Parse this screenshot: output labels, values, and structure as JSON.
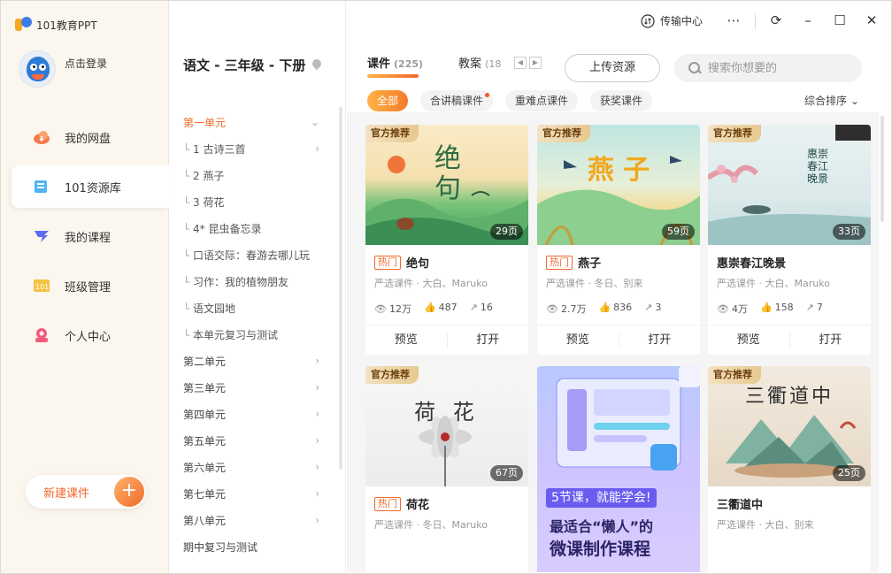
{
  "app": {
    "brand": "101教育PPT"
  },
  "user": {
    "login_label": "点击登录"
  },
  "nav": {
    "items": [
      {
        "label": "我的网盘",
        "icon": "cloud-disk-icon"
      },
      {
        "label": "101资源库",
        "icon": "resource-library-icon",
        "active": true
      },
      {
        "label": "我的课程",
        "icon": "course-icon"
      },
      {
        "label": "班级管理",
        "icon": "class-icon"
      },
      {
        "label": "个人中心",
        "icon": "user-center-icon"
      }
    ],
    "new_button": "新建课件"
  },
  "chapter": {
    "title": "语文 - 三年级 - 下册",
    "units": [
      {
        "label": "第一单元",
        "type": "unit-active"
      },
      {
        "label": "1 古诗三首",
        "type": "sub",
        "chev": true
      },
      {
        "label": "2 燕子",
        "type": "sub"
      },
      {
        "label": "3 荷花",
        "type": "sub"
      },
      {
        "label": "4* 昆虫备忘录",
        "type": "sub"
      },
      {
        "label": "口语交际：春游去哪儿玩",
        "type": "sub"
      },
      {
        "label": "习作：我的植物朋友",
        "type": "sub"
      },
      {
        "label": "语文园地",
        "type": "sub"
      },
      {
        "label": "本单元复习与测试",
        "type": "sub"
      },
      {
        "label": "第二单元",
        "type": "unit",
        "chev": true
      },
      {
        "label": "第三单元",
        "type": "unit",
        "chev": true
      },
      {
        "label": "第四单元",
        "type": "unit",
        "chev": true
      },
      {
        "label": "第五单元",
        "type": "unit",
        "chev": true
      },
      {
        "label": "第六单元",
        "type": "unit",
        "chev": true
      },
      {
        "label": "第七单元",
        "type": "unit",
        "chev": true
      },
      {
        "label": "第八单元",
        "type": "unit",
        "chev": true
      },
      {
        "label": "期中复习与测试",
        "type": "unit"
      }
    ]
  },
  "titlebar": {
    "transfer": "传输中心"
  },
  "tabs": [
    {
      "label": "课件",
      "count": "(225)"
    },
    {
      "label": "教案",
      "count": "(18"
    }
  ],
  "upload_label": "上传资源",
  "search": {
    "placeholder": "搜索你想要的"
  },
  "filters": [
    "全部",
    "合讲稿课件",
    "重难点课件",
    "获奖课件"
  ],
  "sort_label": "综合排序",
  "official_label": "官方推荐",
  "hot_label": "热门",
  "actions": {
    "preview": "预览",
    "open": "打开"
  },
  "cards": [
    {
      "title": "绝句",
      "hot": true,
      "meta": "严选课件 · 大白、Maruko",
      "pages": "29页",
      "views": "12万",
      "likes": "487",
      "shares": "16",
      "thumb_text": "绝 句"
    },
    {
      "title": "燕子",
      "hot": true,
      "meta": "严选课件 · 冬日、别来",
      "pages": "59页",
      "views": "2.7万",
      "likes": "836",
      "shares": "3",
      "thumb_text": "燕 子"
    },
    {
      "title": "惠崇春江晚景",
      "hot": false,
      "meta": "严选课件 · 大白、Maruko",
      "pages": "33页",
      "views": "4万",
      "likes": "158",
      "shares": "7",
      "thumb_text": "惠崇春江晚景"
    },
    {
      "title": "荷花",
      "hot": true,
      "meta": "严选课件 · 冬日、Maruko",
      "pages": "67页",
      "thumb_text": "荷 花"
    },
    {
      "title": "",
      "hot": false,
      "meta": "",
      "pages": "",
      "ad_line1": "5节课，就能学会!",
      "ad_line2": "最适合“懒人”的",
      "ad_line3": "微课制作课程"
    },
    {
      "title": "三衢道中",
      "hot": false,
      "meta": "严选课件 · 大白、别来",
      "pages": "25页",
      "thumb_text": "三衢道中"
    }
  ]
}
